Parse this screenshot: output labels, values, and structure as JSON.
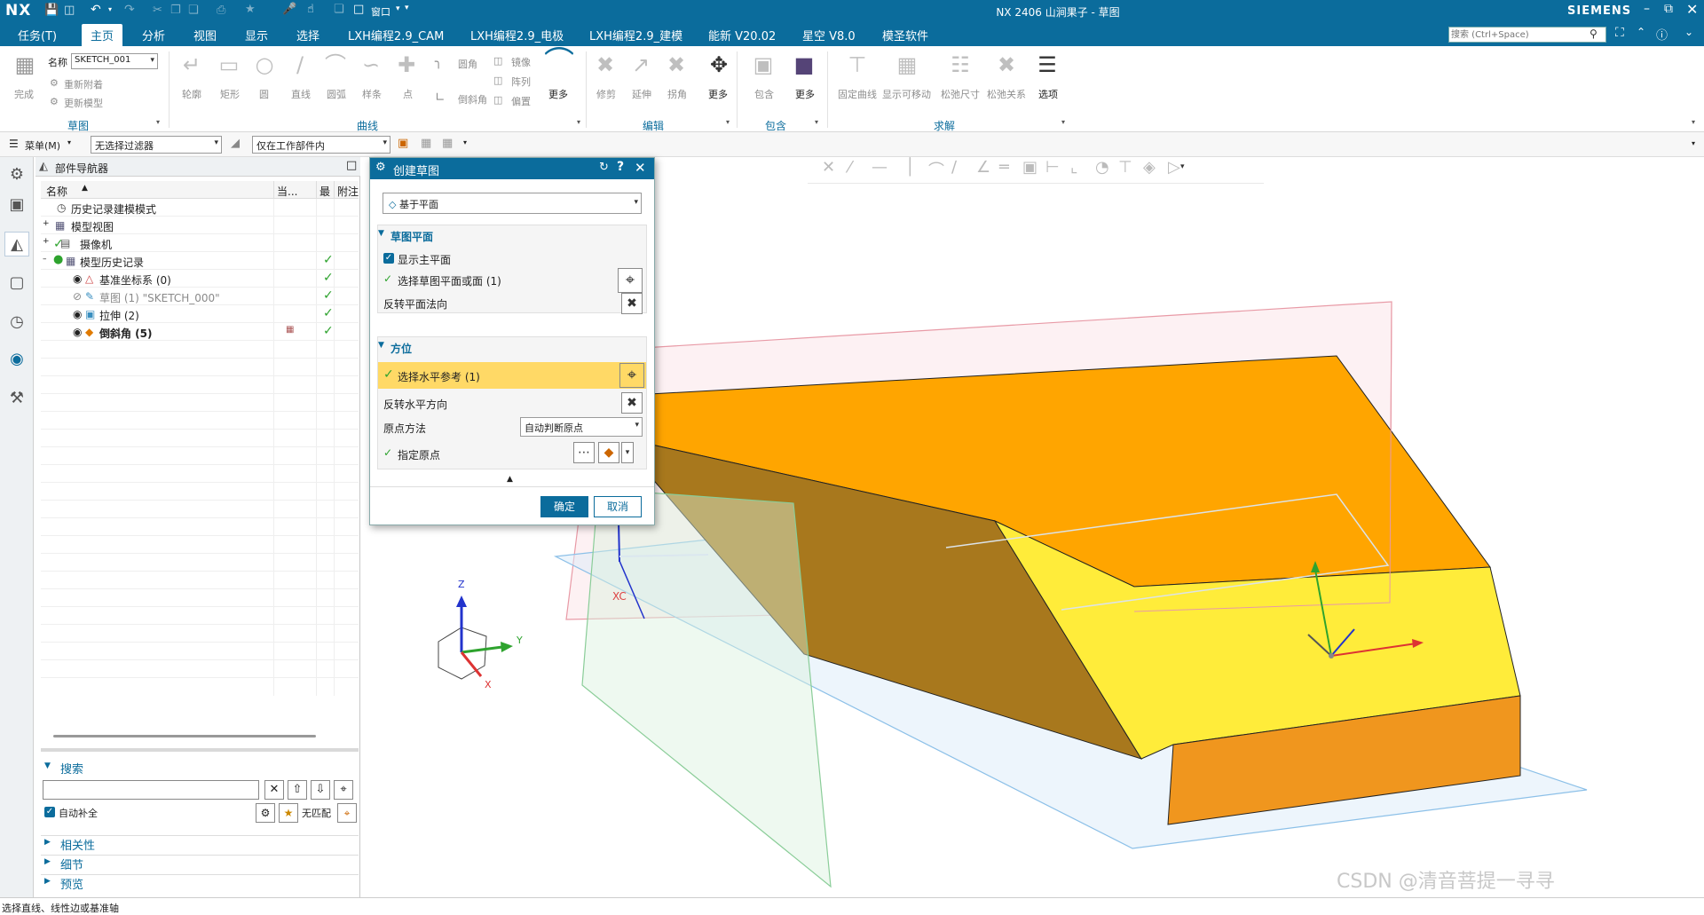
{
  "app": {
    "logo": "NX",
    "window_title": "NX 2406 山涧果子 - 草图",
    "brand": "SIEMENS",
    "window_menu": "窗口",
    "search_placeholder": "搜索 (Ctrl+Space)"
  },
  "menubar": {
    "tabs": [
      "任务(T)",
      "主页",
      "分析",
      "视图",
      "显示",
      "选择",
      "LXH编程2.9_CAM",
      "LXH编程2.9_电极",
      "LXH编程2.9_建模",
      "能新 V20.02",
      "星空 V8.0",
      "模圣软件"
    ],
    "active": "主页"
  },
  "ribbon": {
    "finish_label": "完成",
    "name_label": "名称",
    "sketch_name": "SKETCH_001",
    "reattach": "重新附着",
    "update_model": "更新模型",
    "curve_tools": [
      "轮廓",
      "矩形",
      "圆",
      "直线",
      "圆弧",
      "样条",
      "点"
    ],
    "curve_small": [
      "圆角",
      "倒斜角"
    ],
    "pattern_small": [
      "镜像",
      "阵列",
      "偏置"
    ],
    "more": "更多",
    "edit_tools": [
      "修剪",
      "延伸",
      "拐角"
    ],
    "include": "包含",
    "constraint_tools": [
      "固定曲线",
      "显示可移动",
      "松弛尺寸",
      "松弛关系"
    ],
    "options": "选项",
    "groups": [
      "草图",
      "曲线",
      "编辑",
      "包含",
      "求解"
    ]
  },
  "filterbar": {
    "menu_label": "菜单(M)",
    "selection_filter": "无选择过滤器",
    "scope": "仅在工作部件内"
  },
  "navigator": {
    "title": "部件导航器",
    "columns": [
      "名称",
      "当...",
      "最",
      "附注"
    ],
    "rows": [
      {
        "label": "历史记录建模模式",
        "check": false
      },
      {
        "label": "模型视图",
        "check": false
      },
      {
        "label": "摄像机",
        "check": false
      },
      {
        "label": "模型历史记录",
        "check": true
      },
      {
        "label": "基准坐标系 (0)",
        "check": true
      },
      {
        "label": "草图 (1) \"SKETCH_000\"",
        "check": true
      },
      {
        "label": "拉伸 (2)",
        "check": true
      },
      {
        "label": "倒斜角 (5)",
        "check": true
      }
    ],
    "search_section": "搜索",
    "auto_complete": "自动补全",
    "no_match": "无匹配",
    "panels": [
      "相关性",
      "细节",
      "预览"
    ]
  },
  "dialog": {
    "title": "创建草图",
    "type": "基于平面",
    "sketch_plane_section": "草图平面",
    "show_main_plane": "显示主平面",
    "select_plane": "选择草图平面或面 (1)",
    "reverse_plane": "反转平面法向",
    "orientation_section": "方位",
    "select_horizontal": "选择水平参考 (1)",
    "reverse_horizontal": "反转水平方向",
    "origin_method_label": "原点方法",
    "origin_method": "自动判断原点",
    "specify_origin": "指定原点",
    "ok": "确定",
    "cancel": "取消"
  },
  "viewport": {
    "axis_x": "X",
    "axis_y": "Y",
    "axis_z": "Z",
    "csys_label": "XC",
    "watermark": "CSDN @清音菩提一寻寻"
  },
  "status": {
    "message": "选择直线、线性边或基准轴"
  },
  "colors": {
    "accent": "#0b6c9c",
    "highlight": "#ffd966",
    "solid_top": "#ffa500",
    "solid_front": "#ffec3a",
    "check": "#2ea32e"
  }
}
